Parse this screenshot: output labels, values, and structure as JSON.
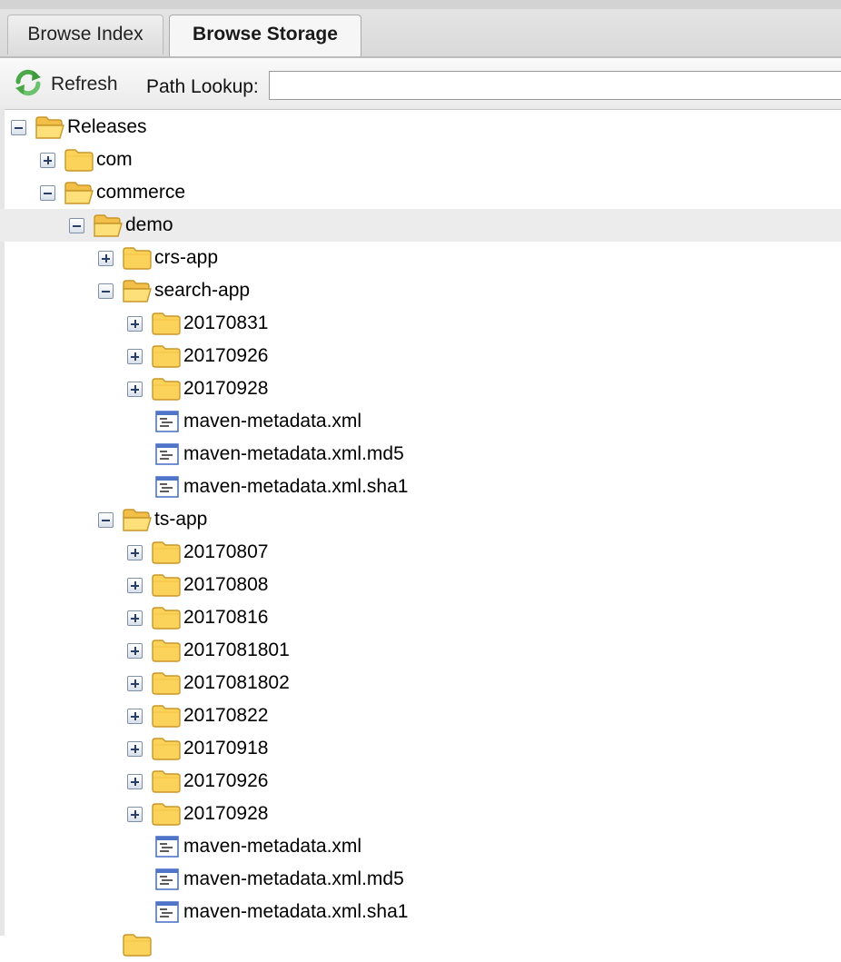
{
  "tabs": [
    {
      "label": "Browse Index",
      "active": false
    },
    {
      "label": "Browse Storage",
      "active": true
    }
  ],
  "toolbar": {
    "refresh_label": "Refresh",
    "path_lookup_label": "Path Lookup:",
    "path_lookup_value": ""
  },
  "colors": {
    "folder_fill": "#fcd35a",
    "folder_stroke": "#c9962a",
    "file_accent": "#4f74c9",
    "selected_row": "#ececec",
    "refresh_green": "#4aa84a"
  },
  "tree": [
    {
      "label": "Releases",
      "depth": 0,
      "kind": "folder",
      "state": "expanded",
      "open": true
    },
    {
      "label": "com",
      "depth": 1,
      "kind": "folder",
      "state": "collapsed",
      "open": false
    },
    {
      "label": "commerce",
      "depth": 1,
      "kind": "folder",
      "state": "expanded",
      "open": true
    },
    {
      "label": "demo",
      "depth": 2,
      "kind": "folder",
      "state": "expanded",
      "open": true,
      "selected": true
    },
    {
      "label": "crs-app",
      "depth": 3,
      "kind": "folder",
      "state": "collapsed",
      "open": false
    },
    {
      "label": "search-app",
      "depth": 3,
      "kind": "folder",
      "state": "expanded",
      "open": true
    },
    {
      "label": "20170831",
      "depth": 4,
      "kind": "folder",
      "state": "collapsed",
      "open": false
    },
    {
      "label": "20170926",
      "depth": 4,
      "kind": "folder",
      "state": "collapsed",
      "open": false
    },
    {
      "label": "20170928",
      "depth": 4,
      "kind": "folder",
      "state": "collapsed",
      "open": false
    },
    {
      "label": "maven-metadata.xml",
      "depth": 4,
      "kind": "file"
    },
    {
      "label": "maven-metadata.xml.md5",
      "depth": 4,
      "kind": "file"
    },
    {
      "label": "maven-metadata.xml.sha1",
      "depth": 4,
      "kind": "file"
    },
    {
      "label": "ts-app",
      "depth": 3,
      "kind": "folder",
      "state": "expanded",
      "open": true
    },
    {
      "label": "20170807",
      "depth": 4,
      "kind": "folder",
      "state": "collapsed",
      "open": false
    },
    {
      "label": "20170808",
      "depth": 4,
      "kind": "folder",
      "state": "collapsed",
      "open": false
    },
    {
      "label": "20170816",
      "depth": 4,
      "kind": "folder",
      "state": "collapsed",
      "open": false
    },
    {
      "label": "2017081801",
      "depth": 4,
      "kind": "folder",
      "state": "collapsed",
      "open": false
    },
    {
      "label": "2017081802",
      "depth": 4,
      "kind": "folder",
      "state": "collapsed",
      "open": false
    },
    {
      "label": "20170822",
      "depth": 4,
      "kind": "folder",
      "state": "collapsed",
      "open": false
    },
    {
      "label": "20170918",
      "depth": 4,
      "kind": "folder",
      "state": "collapsed",
      "open": false
    },
    {
      "label": "20170926",
      "depth": 4,
      "kind": "folder",
      "state": "collapsed",
      "open": false
    },
    {
      "label": "20170928",
      "depth": 4,
      "kind": "folder",
      "state": "collapsed",
      "open": false
    },
    {
      "label": "maven-metadata.xml",
      "depth": 4,
      "kind": "file"
    },
    {
      "label": "maven-metadata.xml.md5",
      "depth": 4,
      "kind": "file"
    },
    {
      "label": "maven-metadata.xml.sha1",
      "depth": 4,
      "kind": "file"
    }
  ]
}
